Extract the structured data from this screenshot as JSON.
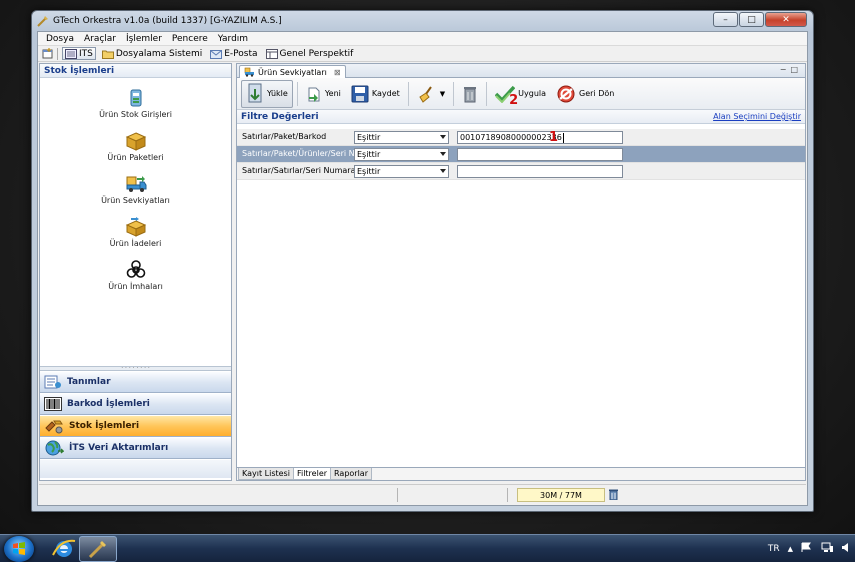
{
  "window": {
    "title": "GTech Orkestra v1.0a (build 1337) [G-YAZILIM A.S.]"
  },
  "menu": [
    "Dosya",
    "Araçlar",
    "İşlemler",
    "Pencere",
    "Yardım"
  ],
  "quickbar": [
    {
      "label": "ITS",
      "icon": "its-icon"
    },
    {
      "label": "Dosyalama Sistemi",
      "icon": "folder-icon"
    },
    {
      "label": "E-Posta",
      "icon": "email-icon"
    },
    {
      "label": "Genel Perspektif",
      "icon": "perspective-icon"
    }
  ],
  "left_panel": {
    "header": "Stok İşlemleri",
    "items": [
      {
        "label": "Ürün Stok Girişleri",
        "icon": "stock-entry-icon"
      },
      {
        "label": "Ürün Paketleri",
        "icon": "package-icon"
      },
      {
        "label": "Ürün Sevkiyatları",
        "icon": "truck-icon"
      },
      {
        "label": "Ürün İadeleri",
        "icon": "return-icon"
      },
      {
        "label": "Ürün İmhaları",
        "icon": "biohazard-icon"
      }
    ],
    "nav": [
      {
        "label": "Tanımlar",
        "icon": "definitions-icon"
      },
      {
        "label": "Barkod İşlemleri",
        "icon": "barcode-icon"
      },
      {
        "label": "Stok İşlemleri",
        "icon": "stock-icon",
        "active": true
      },
      {
        "label": "İTS Veri Aktarımları",
        "icon": "globe-icon"
      }
    ]
  },
  "document": {
    "tab_title": "Ürün Sevkiyatları",
    "toolbar": [
      {
        "label": "Yükle",
        "icon": "load-icon",
        "pressed": true
      },
      {
        "label": "Yeni",
        "icon": "new-icon"
      },
      {
        "label": "Kaydet",
        "icon": "save-icon"
      },
      {
        "label": "",
        "icon": "broom-icon"
      },
      {
        "label": "",
        "icon": "delete-icon"
      },
      {
        "label": "Uygula",
        "icon": "apply-icon"
      },
      {
        "label": "Geri Dön",
        "icon": "back-icon"
      }
    ],
    "filter_header": "Filtre Değerleri",
    "filter_link": "Alan Seçimini Değiştir",
    "filters": [
      {
        "field": "Satırlar/Paket/Barkod",
        "operator": "Eşittir",
        "value": "00107189080000002336"
      },
      {
        "field": "Satırlar/Paket/Ürünler/Seri No",
        "operator": "Eşittir",
        "value": ""
      },
      {
        "field": "Satırlar/Satırlar/Seri Numarası",
        "operator": "Eşittir",
        "value": ""
      }
    ],
    "annotations": {
      "one": "1",
      "two": "2"
    },
    "bottom_tabs": [
      "Kayıt Listesi",
      "Filtreler",
      "Raporlar"
    ]
  },
  "status": {
    "memory": "30M / 77M"
  },
  "taskbar": {
    "lang": "TR"
  }
}
